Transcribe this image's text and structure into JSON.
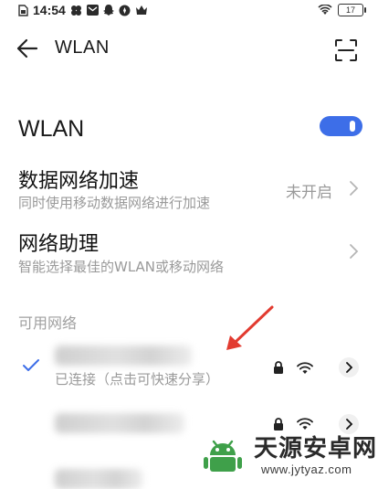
{
  "status_bar": {
    "time": "14:54",
    "battery": "17",
    "left_icons": [
      "sim-icon",
      "gallery-icon",
      "mail-icon",
      "snapchat-icon",
      "compass-icon",
      "crown-icon"
    ],
    "right_icons": [
      "wifi-status-icon",
      "battery-icon"
    ]
  },
  "header": {
    "title": "WLAN",
    "back_icon": "arrow-left-icon",
    "scan_icon": "scan-icon"
  },
  "wlan": {
    "label": "WLAN",
    "enabled": true,
    "accent_color": "#3d6ee8"
  },
  "settings": [
    {
      "title": "数据网络加速",
      "subtitle": "同时使用移动数据网络进行加速",
      "value": "未开启"
    },
    {
      "title": "网络助理",
      "subtitle": "智能选择最佳的WLAN或移动网络",
      "value": ""
    }
  ],
  "available_networks": {
    "header": "可用网络",
    "networks": [
      {
        "connected": true,
        "subtitle": "已连接（点击可快速分享）",
        "secured": true
      },
      {
        "connected": false,
        "subtitle": "",
        "secured": true
      },
      {
        "connected": false,
        "subtitle": "",
        "secured": false
      }
    ]
  },
  "watermark": {
    "title": "天源安卓网",
    "url": "www.jytyaz.com"
  }
}
